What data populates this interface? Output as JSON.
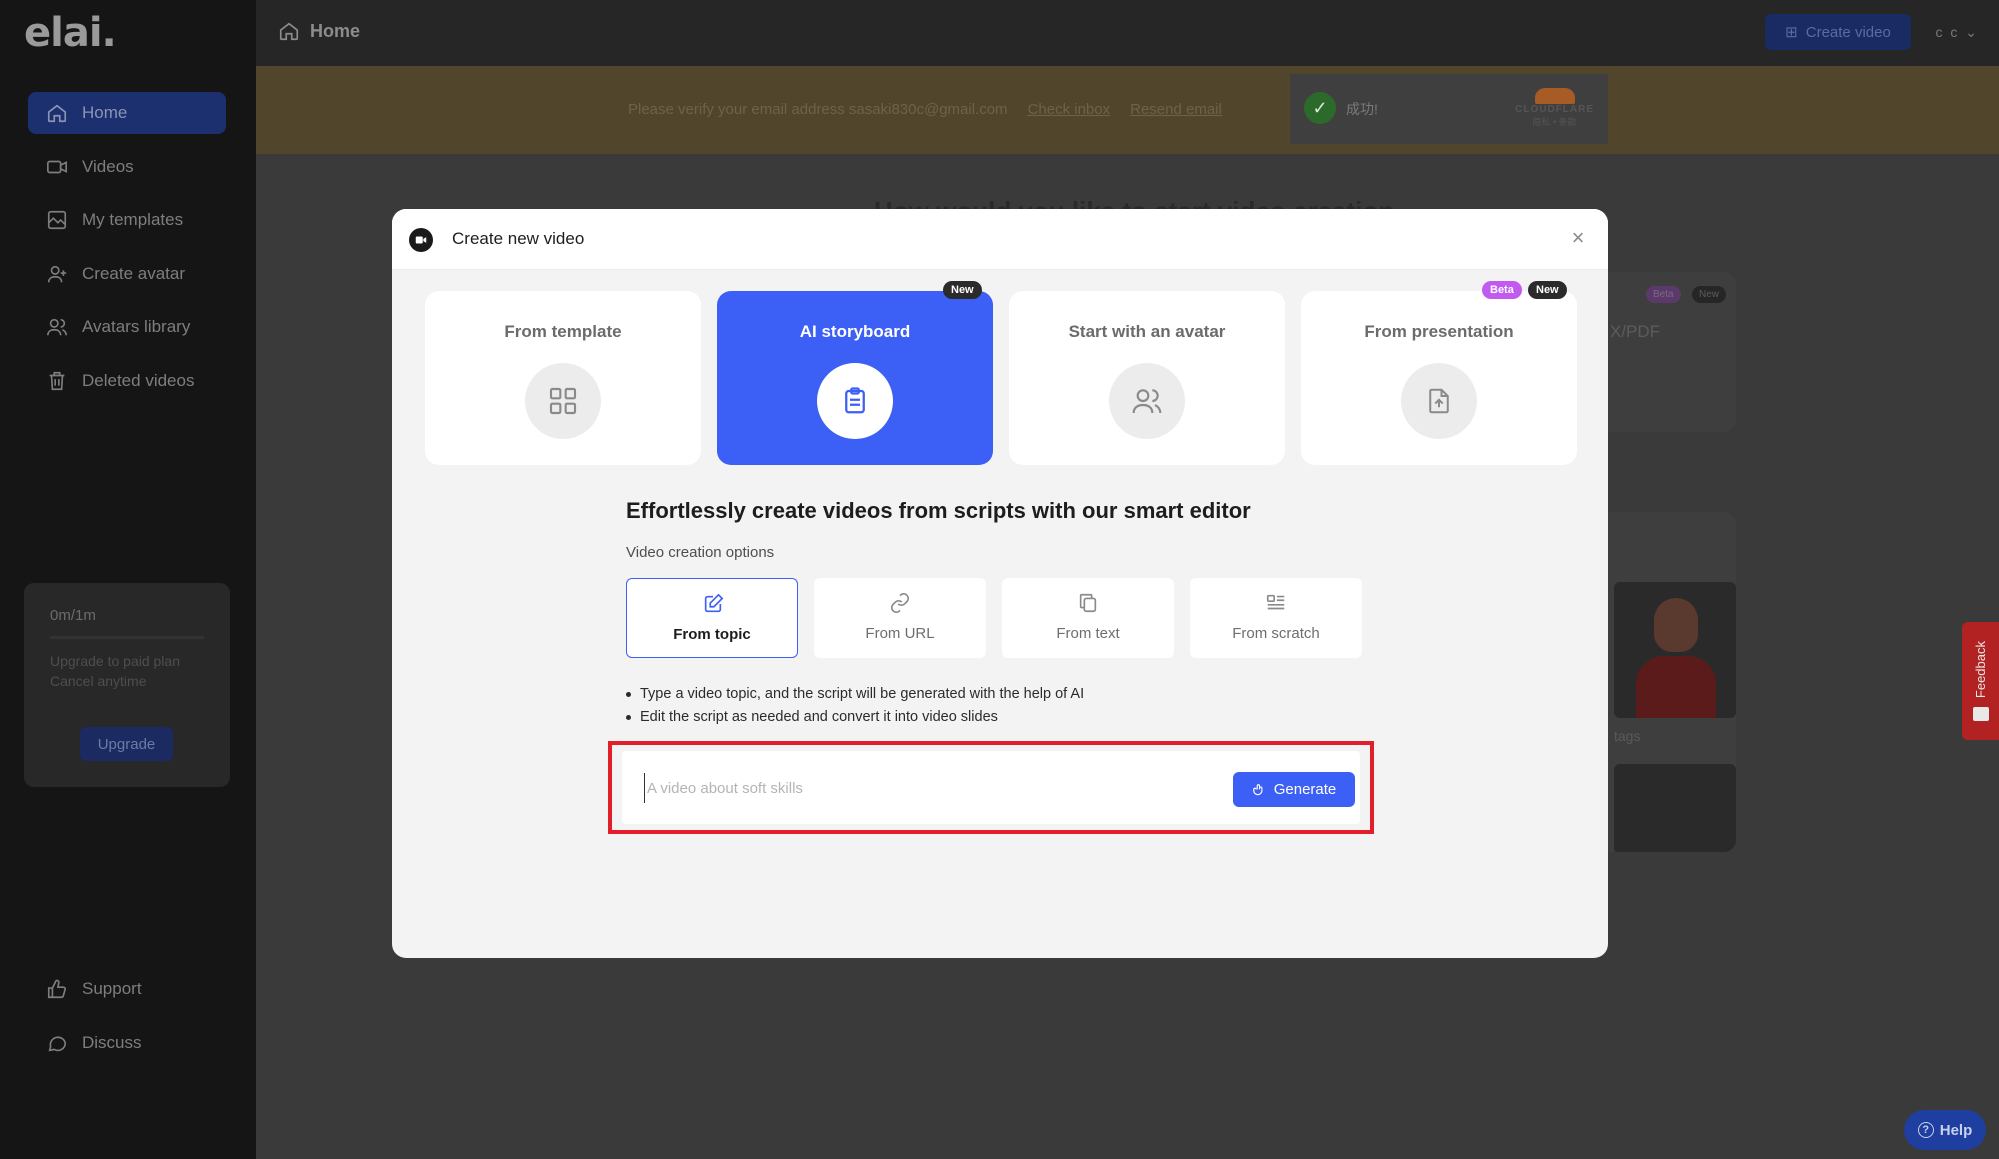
{
  "app": {
    "logo_text": "elai."
  },
  "sidebar": {
    "items": [
      {
        "label": "Home",
        "icon": "home-icon"
      },
      {
        "label": "Videos",
        "icon": "video-camera-icon"
      },
      {
        "label": "My templates",
        "icon": "templates-icon"
      },
      {
        "label": "Create avatar",
        "icon": "user-plus-icon"
      },
      {
        "label": "Avatars library",
        "icon": "users-icon"
      },
      {
        "label": "Deleted videos",
        "icon": "trash-icon"
      }
    ],
    "plan": {
      "usage": "0m/1m",
      "note_line1": "Upgrade to paid plan",
      "note_line2": "Cancel anytime",
      "upgrade_label": "Upgrade"
    },
    "bottom_items": [
      {
        "label": "Support",
        "icon": "thumbs-up-icon"
      },
      {
        "label": "Discuss",
        "icon": "chat-bubble-icon"
      }
    ]
  },
  "topbar": {
    "title": "Home",
    "create_video_label": "Create video",
    "user_initials": "c c"
  },
  "banner": {
    "message": "Please verify your email address sasaki830c@gmail.com",
    "check_inbox": "Check inbox",
    "resend_email": "Resend email",
    "captcha_status": "成功!",
    "captcha_brand": "CLOUDFLARE",
    "captcha_links": "隐私 • 条款"
  },
  "background_page": {
    "heading": "How would you like to start video creation",
    "card_label": "X/PDF",
    "badge_beta": "Beta",
    "badge_new": "New",
    "tags_label": "tags"
  },
  "modal": {
    "title": "Create new video",
    "close_symbol": "×",
    "types": [
      {
        "label": "From template",
        "icon": "grid-icon"
      },
      {
        "label": "AI storyboard",
        "icon": "clipboard-icon",
        "badge": "New"
      },
      {
        "label": "Start with an avatar",
        "icon": "users-icon"
      },
      {
        "label": "From presentation",
        "icon": "file-upload-icon",
        "badges": [
          "Beta",
          "New"
        ]
      }
    ],
    "headline": "Effortlessly create videos from scripts with our smart editor",
    "options_label": "Video creation options",
    "options": [
      {
        "label": "From topic",
        "icon": "edit-icon",
        "selected": true
      },
      {
        "label": "From URL",
        "icon": "link-icon"
      },
      {
        "label": "From text",
        "icon": "copy-icon"
      },
      {
        "label": "From scratch",
        "icon": "list-icon"
      }
    ],
    "bullets": [
      "Type a video topic, and the script will be generated with the help of AI",
      "Edit the script as needed and convert it into video slides"
    ],
    "prompt": {
      "placeholder": "A video about soft skills",
      "value": ""
    },
    "generate_label": "Generate"
  },
  "widgets": {
    "feedback_label": "Feedback",
    "help_label": "Help"
  },
  "colors": {
    "accent": "#3c5ff5",
    "highlight": "#e31e2b",
    "sidebar_bg": "#151515"
  }
}
